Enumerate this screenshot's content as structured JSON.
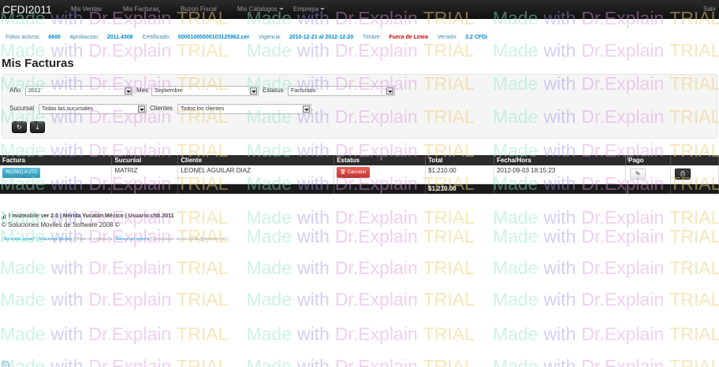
{
  "app": {
    "brand": "CFDI2011",
    "nav": [
      "Mis Ventas",
      "Mis Facturas",
      "Buzon Fiscal",
      "Mis Catalogos",
      "Empresa"
    ],
    "logout": "Salir"
  },
  "info": {
    "folios_label": "Folios activos:",
    "folios_value": "6600",
    "aprobacion_label": "Aprobacion:",
    "aprobacion_value": "2011.4308",
    "certificado_label": "Certificado:",
    "certificado_value": "00001000000103125962.cer",
    "vigencia_label": "Vigencia:",
    "vigencia_value": "2010-12-21 al 2012-12-20",
    "timbre_label": "Timbre:",
    "timbre_value": "Fuera de Linea",
    "version_label": "Versión:",
    "version_value": "3.2 CFDi"
  },
  "page_title": "Mis Facturas",
  "filters": {
    "anio_label": "Año",
    "anio_value": "2012",
    "mes_label": "Mes",
    "mes_value": "Septiembre",
    "estatus_label": "Estatus",
    "estatus_value": "Facturado",
    "sucursal_label": "Sucursal",
    "sucursal_value": "Todas las sucursales",
    "clientes_label": "Clientes",
    "clientes_value": "Todos los clientes"
  },
  "table": {
    "headers": [
      "Factura",
      "Sucursal",
      "Cliente",
      "Estatus",
      "Total",
      "Fecha/Hora",
      "Pago",
      ""
    ],
    "row": {
      "factura": "(1581) A-272",
      "sucursal": "MATRIZ",
      "cliente": "LEONEL AGUILAR DIAZ",
      "estatus_btn": "Cancelar",
      "total": "$1,210.00",
      "fecha": "2012-09-03 18:15:23"
    },
    "grand_total": "$1,210.00"
  },
  "footer": {
    "line1": "| midmobile ver 2.0 | Mérida Yucatán México | Usuario:cfdi.2011",
    "line2": "© Soluciones Moviles de Software 2008 ©",
    "link_help": "Necesitas ayuda?",
    "link_soluciones": "Soluciones Moviles",
    "forgot": "Olvide mi contraseña",
    "link_manual": "Manual del sistema",
    "comments": "comentarios: leonel.aguilar@smamid.com"
  },
  "watermark": {
    "made": "Made",
    "with": "with",
    "brand": "Dr.Explain",
    "trial": "TRIAL"
  }
}
